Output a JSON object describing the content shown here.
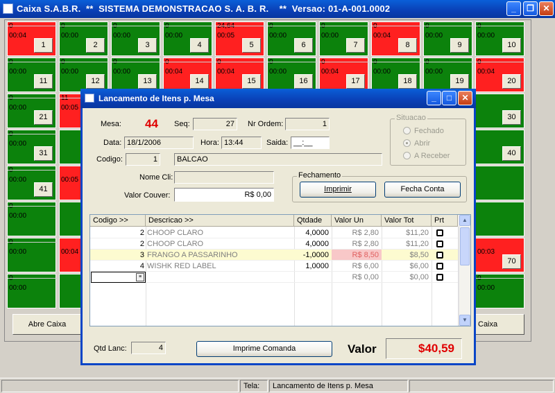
{
  "window": {
    "title": "Caixa S.A.B.R.  **  SISTEMA DEMONSTRACAO S. A. B. R.    **  Versao: 01-A-001.0002"
  },
  "tiles": [
    {
      "n": "1",
      "time": "00:04",
      "zero": "0",
      "color": "red"
    },
    {
      "n": "2",
      "time": "00:00",
      "zero": "0",
      "color": "green"
    },
    {
      "n": "3",
      "time": "00:00",
      "zero": "0",
      "color": "green"
    },
    {
      "n": "4",
      "time": "00:00",
      "zero": "0",
      "color": "green"
    },
    {
      "n": "5",
      "time": "00:05",
      "zero": "24,64",
      "color": "red"
    },
    {
      "n": "6",
      "time": "00:00",
      "zero": "0",
      "color": "green"
    },
    {
      "n": "7",
      "time": "00:00",
      "zero": "0",
      "color": "green"
    },
    {
      "n": "8",
      "time": "00:04",
      "zero": "0",
      "color": "red"
    },
    {
      "n": "9",
      "time": "00:00",
      "zero": "0",
      "color": "green"
    },
    {
      "n": "10",
      "time": "00:00",
      "zero": "0",
      "color": "green"
    },
    {
      "n": "11",
      "time": "00:00",
      "zero": "0",
      "color": "green"
    },
    {
      "n": "12",
      "time": "00:00",
      "zero": "0",
      "color": "green"
    },
    {
      "n": "13",
      "time": "00:00",
      "zero": "0",
      "color": "green"
    },
    {
      "n": "14",
      "time": "00:04",
      "zero": "0",
      "color": "red"
    },
    {
      "n": "15",
      "time": "00:04",
      "zero": "0",
      "color": "red"
    },
    {
      "n": "16",
      "time": "00:00",
      "zero": "0",
      "color": "green"
    },
    {
      "n": "17",
      "time": "00:04",
      "zero": "0",
      "color": "red"
    },
    {
      "n": "18",
      "time": "00:00",
      "zero": "0",
      "color": "green"
    },
    {
      "n": "19",
      "time": "00:00",
      "zero": "0",
      "color": "green"
    },
    {
      "n": "20",
      "time": "00:04",
      "zero": "0",
      "color": "red"
    },
    {
      "n": "21",
      "time": "00:00",
      "zero": "0",
      "color": "green"
    },
    {
      "n": "",
      "time": "00:05",
      "zero": "11",
      "color": "red"
    },
    {
      "n": "30",
      "time": "",
      "zero": "",
      "color": "green"
    },
    {
      "n": "31",
      "time": "00:00",
      "zero": "0",
      "color": "green"
    },
    {
      "n": "",
      "time": "",
      "zero": "",
      "color": "green"
    },
    {
      "n": "40",
      "time": "",
      "zero": "",
      "color": "green"
    },
    {
      "n": "41",
      "time": "00:00",
      "zero": "0",
      "color": "green"
    },
    {
      "n": "",
      "time": "00:05",
      "zero": "",
      "color": "red"
    },
    {
      "n": "",
      "time": "",
      "zero": "",
      "color": "green"
    },
    {
      "n": "",
      "time": "00:00",
      "zero": "0",
      "color": "green"
    },
    {
      "n": "",
      "time": "",
      "zero": "",
      "color": "green"
    },
    {
      "n": "",
      "time": "",
      "zero": "",
      "color": "green"
    },
    {
      "n": "",
      "time": "00:00",
      "zero": "0",
      "color": "green"
    },
    {
      "n": "",
      "time": "00:04",
      "zero": "",
      "color": "red"
    },
    {
      "n": "70",
      "time": "00:03",
      "zero": "",
      "color": "red"
    },
    {
      "n": "",
      "time": "00:00",
      "zero": "0",
      "color": "green"
    },
    {
      "n": "",
      "time": "",
      "zero": "",
      "color": "green"
    },
    {
      "n": "",
      "time": "00:00",
      "zero": "0",
      "color": "green"
    }
  ],
  "bottom_buttons": {
    "abre_caixa": "Abre Caixa",
    "right_partial": "Caixa"
  },
  "statusbar": {
    "label": "Tela:",
    "value": "Lancamento de Itens p. Mesa"
  },
  "dialog": {
    "title": "Lancamento de Itens p. Mesa",
    "mesa_label": "Mesa:",
    "mesa_value": "44",
    "seq_label": "Seq:",
    "seq_value": "27",
    "nr_ordem_label": "Nr Ordem:",
    "nr_ordem_value": "1",
    "data_label": "Data:",
    "data_value": "18/1/2006",
    "hora_label": "Hora:",
    "hora_value": "13:44",
    "saida_label": "Saida:",
    "saida_value": "__:__",
    "codigo_label": "Codigo:",
    "codigo_value": "1",
    "codigo_desc": "BALCAO",
    "nome_cli_label": "Nome Cli:",
    "nome_cli_value": "",
    "valor_couver_label": "Valor Couver:",
    "valor_couver_value": "R$ 0,00",
    "situacao": {
      "title": "Situacao",
      "options": [
        "Fechado",
        "Abrir",
        "A Receber"
      ],
      "selected": "Abrir"
    },
    "fechamento": {
      "title": "Fechamento",
      "imprimir": "Imprimir",
      "fecha_conta": "Fecha Conta"
    },
    "grid": {
      "headers": [
        "Codigo >>",
        "Descricao >>",
        "Qtdade",
        "Valor Un",
        "Valor Tot",
        "Prt"
      ],
      "rows": [
        {
          "codigo": "2",
          "descricao": "CHOOP CLARO",
          "qtd": "4,0000",
          "un": "R$ 2,80",
          "tot": "$11,20",
          "highlight": false
        },
        {
          "codigo": "2",
          "descricao": "CHOOP CLARO",
          "qtd": "4,0000",
          "un": "R$ 2,80",
          "tot": "$11,20",
          "highlight": false
        },
        {
          "codigo": "3",
          "descricao": "FRANGO A PASSARINHO",
          "qtd": "-1,0000",
          "un": "R$ 8,50",
          "tot": "$8,50",
          "highlight": true
        },
        {
          "codigo": "4",
          "descricao": "WISHK RED LABEL",
          "qtd": "1,0000",
          "un": "R$ 6,00",
          "tot": "$6,00",
          "highlight": false
        },
        {
          "codigo": "",
          "descricao": "",
          "qtd": "",
          "un": "R$ 0,00",
          "tot": "$0,00",
          "highlight": false
        }
      ]
    },
    "qtd_lanc_label": "Qtd Lanc:",
    "qtd_lanc_value": "4",
    "imprime_comanda": "Imprime Comanda",
    "valor_label": "Valor",
    "valor_value": "$40,59"
  },
  "colors": {
    "green": "#0c820c",
    "red": "#ff2020",
    "accent_red": "#e00000",
    "titlebar": "#0a3fb5"
  },
  "icons": [
    "app-icon",
    "minimize-icon",
    "restore-icon",
    "close-icon",
    "scroll-up-icon",
    "scroll-down-icon",
    "checkbox-icon",
    "ellipsis-icon"
  ]
}
